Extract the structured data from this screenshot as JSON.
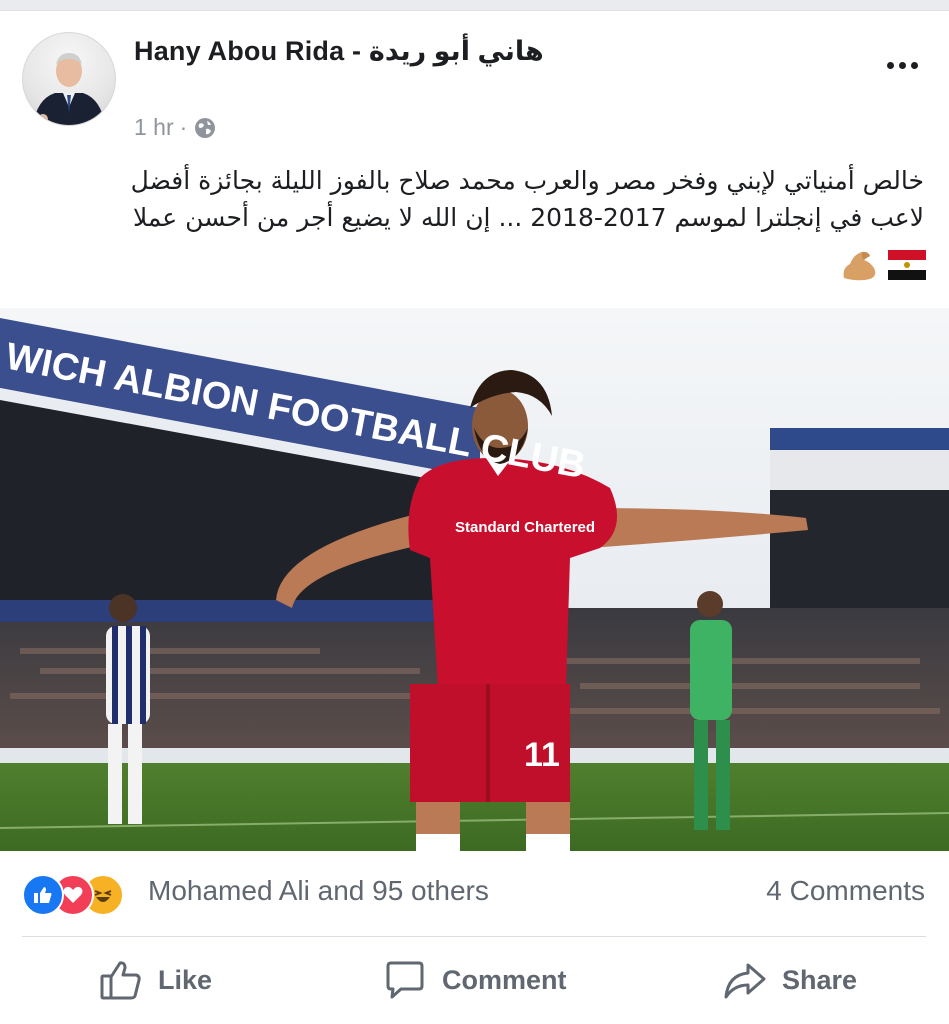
{
  "post": {
    "author_name": "Hany Abou Rida - هاني أبو ريدة",
    "timestamp": "1 hr",
    "separator": "·",
    "privacy_icon": "globe-icon",
    "more_icon": "more-options-icon",
    "text_line1": "خالص أمنياتي لإبني وفخر مصر والعرب محمد صلاح بالفوز الليلة بجائزة أفضل",
    "text_line2": "لاعب في إنجلترا لموسم 2017-2018 ... إن الله لا يضيع أجر من أحسن عملا",
    "emoji_icons": [
      "egypt-flag-icon",
      "flexed-biceps-icon"
    ]
  },
  "photo": {
    "stadium_banner": "WICH ALBION FOOTBALL CLUB",
    "shirt_sponsor": "Standard Chartered",
    "shirt_number": "11"
  },
  "reactions": {
    "icons": [
      "like-reaction-icon",
      "love-reaction-icon",
      "haha-reaction-icon"
    ],
    "summary": "Mohamed Ali and 95 others",
    "comments": "4 Comments"
  },
  "actions": {
    "like": "Like",
    "comment": "Comment",
    "share": "Share"
  },
  "colors": {
    "like_blue": "#1877f2",
    "love_red": "#f33e58",
    "haha_yellow": "#f7b125",
    "text_secondary": "#606770",
    "liverpool_red": "#c8102e"
  }
}
